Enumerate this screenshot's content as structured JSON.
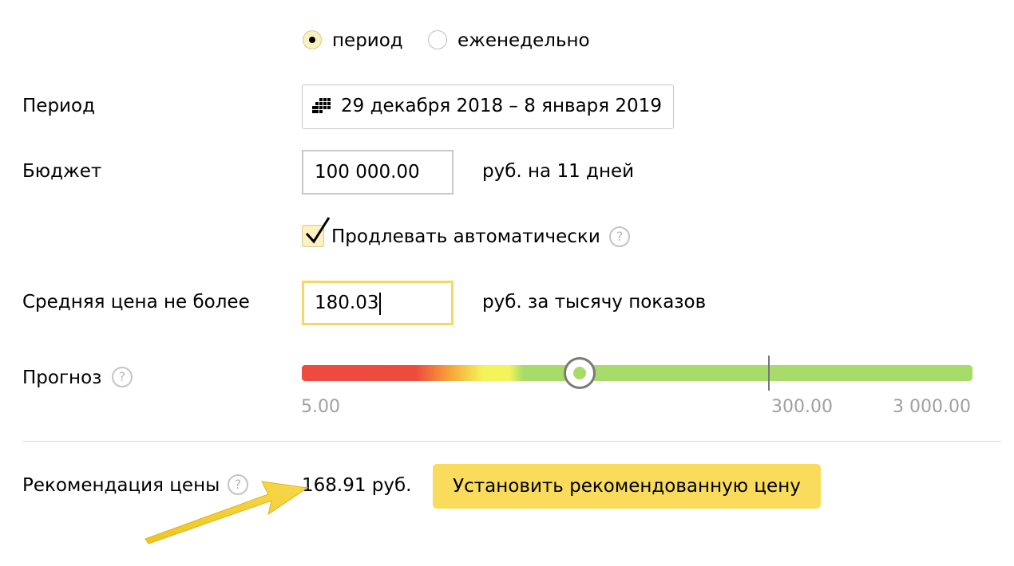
{
  "schedule": {
    "options": [
      {
        "label": "период",
        "selected": true
      },
      {
        "label": "еженедельно",
        "selected": false
      }
    ]
  },
  "period": {
    "label": "Период",
    "value": "29 декабря 2018 – 8 января 2019",
    "icon": "calendar-icon"
  },
  "budget": {
    "label": "Бюджет",
    "value": "100 000.00",
    "suffix": "руб. на 11 дней"
  },
  "auto_extend": {
    "label": "Продлевать автоматически",
    "checked": true,
    "help": "?"
  },
  "avg_price": {
    "label": "Средняя цена не более",
    "value": "180.03",
    "suffix": "руб. за тысячу показов"
  },
  "forecast": {
    "label": "Прогноз",
    "help": "?",
    "scale_min": "5.00",
    "scale_mid": "300.00",
    "scale_max": "3 000.00",
    "colors": {
      "red": "#ef4a3f",
      "orange": "#f7a33a",
      "yellow": "#f3f35a",
      "green": "#a8dc6a"
    }
  },
  "recommendation": {
    "label": "Рекомендация цены",
    "help": "?",
    "value": "168.91 руб.",
    "button_label": "Установить рекомендованную цену"
  },
  "accent_color": "#f9dc5c"
}
